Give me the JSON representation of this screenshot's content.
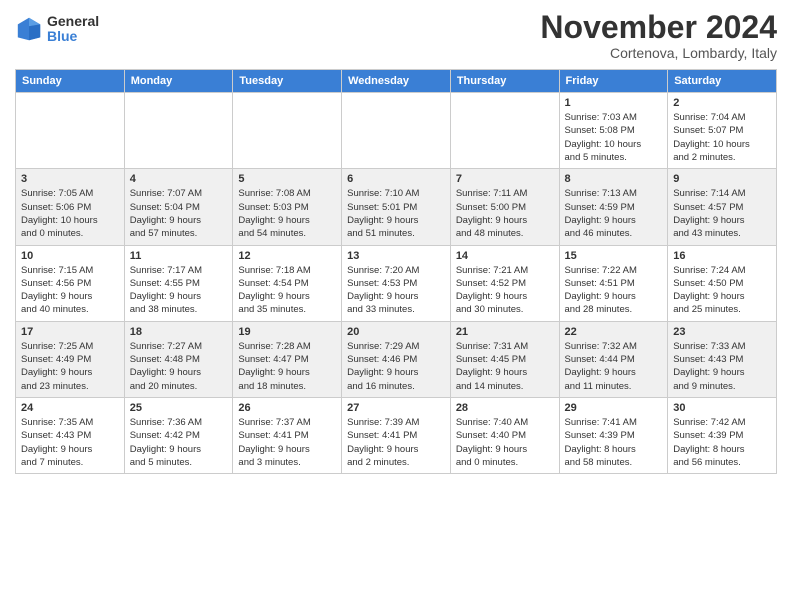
{
  "logo": {
    "general": "General",
    "blue": "Blue"
  },
  "title": "November 2024",
  "location": "Cortenova, Lombardy, Italy",
  "headers": [
    "Sunday",
    "Monday",
    "Tuesday",
    "Wednesday",
    "Thursday",
    "Friday",
    "Saturday"
  ],
  "weeks": [
    [
      {
        "day": "",
        "info": ""
      },
      {
        "day": "",
        "info": ""
      },
      {
        "day": "",
        "info": ""
      },
      {
        "day": "",
        "info": ""
      },
      {
        "day": "",
        "info": ""
      },
      {
        "day": "1",
        "info": "Sunrise: 7:03 AM\nSunset: 5:08 PM\nDaylight: 10 hours\nand 5 minutes."
      },
      {
        "day": "2",
        "info": "Sunrise: 7:04 AM\nSunset: 5:07 PM\nDaylight: 10 hours\nand 2 minutes."
      }
    ],
    [
      {
        "day": "3",
        "info": "Sunrise: 7:05 AM\nSunset: 5:06 PM\nDaylight: 10 hours\nand 0 minutes."
      },
      {
        "day": "4",
        "info": "Sunrise: 7:07 AM\nSunset: 5:04 PM\nDaylight: 9 hours\nand 57 minutes."
      },
      {
        "day": "5",
        "info": "Sunrise: 7:08 AM\nSunset: 5:03 PM\nDaylight: 9 hours\nand 54 minutes."
      },
      {
        "day": "6",
        "info": "Sunrise: 7:10 AM\nSunset: 5:01 PM\nDaylight: 9 hours\nand 51 minutes."
      },
      {
        "day": "7",
        "info": "Sunrise: 7:11 AM\nSunset: 5:00 PM\nDaylight: 9 hours\nand 48 minutes."
      },
      {
        "day": "8",
        "info": "Sunrise: 7:13 AM\nSunset: 4:59 PM\nDaylight: 9 hours\nand 46 minutes."
      },
      {
        "day": "9",
        "info": "Sunrise: 7:14 AM\nSunset: 4:57 PM\nDaylight: 9 hours\nand 43 minutes."
      }
    ],
    [
      {
        "day": "10",
        "info": "Sunrise: 7:15 AM\nSunset: 4:56 PM\nDaylight: 9 hours\nand 40 minutes."
      },
      {
        "day": "11",
        "info": "Sunrise: 7:17 AM\nSunset: 4:55 PM\nDaylight: 9 hours\nand 38 minutes."
      },
      {
        "day": "12",
        "info": "Sunrise: 7:18 AM\nSunset: 4:54 PM\nDaylight: 9 hours\nand 35 minutes."
      },
      {
        "day": "13",
        "info": "Sunrise: 7:20 AM\nSunset: 4:53 PM\nDaylight: 9 hours\nand 33 minutes."
      },
      {
        "day": "14",
        "info": "Sunrise: 7:21 AM\nSunset: 4:52 PM\nDaylight: 9 hours\nand 30 minutes."
      },
      {
        "day": "15",
        "info": "Sunrise: 7:22 AM\nSunset: 4:51 PM\nDaylight: 9 hours\nand 28 minutes."
      },
      {
        "day": "16",
        "info": "Sunrise: 7:24 AM\nSunset: 4:50 PM\nDaylight: 9 hours\nand 25 minutes."
      }
    ],
    [
      {
        "day": "17",
        "info": "Sunrise: 7:25 AM\nSunset: 4:49 PM\nDaylight: 9 hours\nand 23 minutes."
      },
      {
        "day": "18",
        "info": "Sunrise: 7:27 AM\nSunset: 4:48 PM\nDaylight: 9 hours\nand 20 minutes."
      },
      {
        "day": "19",
        "info": "Sunrise: 7:28 AM\nSunset: 4:47 PM\nDaylight: 9 hours\nand 18 minutes."
      },
      {
        "day": "20",
        "info": "Sunrise: 7:29 AM\nSunset: 4:46 PM\nDaylight: 9 hours\nand 16 minutes."
      },
      {
        "day": "21",
        "info": "Sunrise: 7:31 AM\nSunset: 4:45 PM\nDaylight: 9 hours\nand 14 minutes."
      },
      {
        "day": "22",
        "info": "Sunrise: 7:32 AM\nSunset: 4:44 PM\nDaylight: 9 hours\nand 11 minutes."
      },
      {
        "day": "23",
        "info": "Sunrise: 7:33 AM\nSunset: 4:43 PM\nDaylight: 9 hours\nand 9 minutes."
      }
    ],
    [
      {
        "day": "24",
        "info": "Sunrise: 7:35 AM\nSunset: 4:43 PM\nDaylight: 9 hours\nand 7 minutes."
      },
      {
        "day": "25",
        "info": "Sunrise: 7:36 AM\nSunset: 4:42 PM\nDaylight: 9 hours\nand 5 minutes."
      },
      {
        "day": "26",
        "info": "Sunrise: 7:37 AM\nSunset: 4:41 PM\nDaylight: 9 hours\nand 3 minutes."
      },
      {
        "day": "27",
        "info": "Sunrise: 7:39 AM\nSunset: 4:41 PM\nDaylight: 9 hours\nand 2 minutes."
      },
      {
        "day": "28",
        "info": "Sunrise: 7:40 AM\nSunset: 4:40 PM\nDaylight: 9 hours\nand 0 minutes."
      },
      {
        "day": "29",
        "info": "Sunrise: 7:41 AM\nSunset: 4:39 PM\nDaylight: 8 hours\nand 58 minutes."
      },
      {
        "day": "30",
        "info": "Sunrise: 7:42 AM\nSunset: 4:39 PM\nDaylight: 8 hours\nand 56 minutes."
      }
    ]
  ]
}
